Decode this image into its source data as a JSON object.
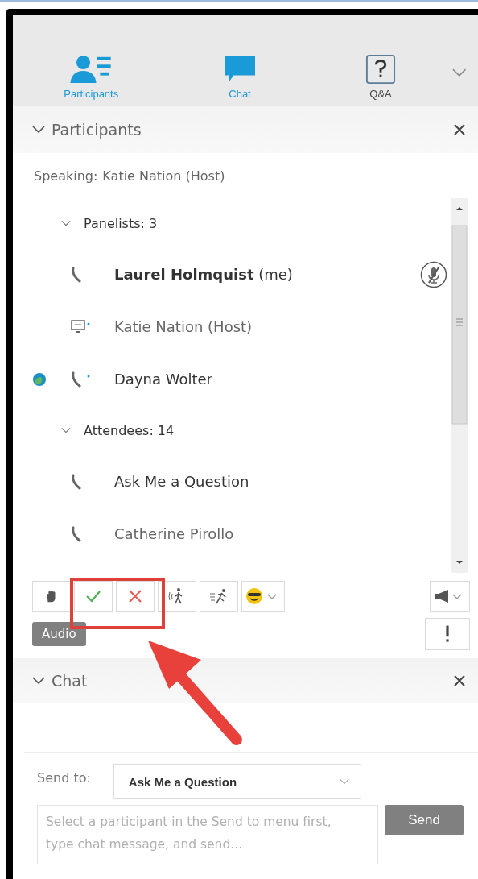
{
  "tabs": [
    {
      "label": "Participants",
      "kind": "people",
      "selected": true
    },
    {
      "label": "Chat",
      "kind": "chat",
      "selected": true
    },
    {
      "label": "Q&A",
      "kind": "question",
      "selected": false
    }
  ],
  "participants_panel": {
    "title": "Participants",
    "speaking_label": "Speaking:",
    "speaking_name": "Katie Nation (Host)",
    "tree": [
      {
        "label": "Panelists: 3",
        "children": [
          {
            "name": "**Laurel Holmquist** (me)",
            "kind": "phone",
            "muted": true,
            "status": false,
            "dim": false
          },
          {
            "name": "Katie Nation (Host)",
            "kind": "computer",
            "muted": false,
            "status": false,
            "dim": true
          },
          {
            "name": "Dayna Wolter",
            "kind": "phone-active",
            "muted": false,
            "status": true,
            "dim": false
          }
        ]
      },
      {
        "label": "Attendees: 14",
        "children": [
          {
            "name": "Ask Me a Question",
            "kind": "phone",
            "muted": false,
            "status": false,
            "dim": false
          },
          {
            "name": "Catherine Pirollo",
            "kind": "phone",
            "muted": false,
            "status": false,
            "dim": true
          }
        ]
      }
    ],
    "toolbar": [
      {
        "kind": "hand"
      },
      {
        "kind": "check"
      },
      {
        "kind": "cross"
      },
      {
        "kind": "walk"
      },
      {
        "kind": "run"
      },
      {
        "kind": "emoji"
      }
    ],
    "tooltip": "Audio"
  },
  "chat_panel": {
    "title": "Chat",
    "send_to_label": "Send to:",
    "send_to_value": "Ask Me a Question",
    "placeholder": "Select a participant in the Send to menu first, type chat message, and send...",
    "send_button": "Send"
  }
}
